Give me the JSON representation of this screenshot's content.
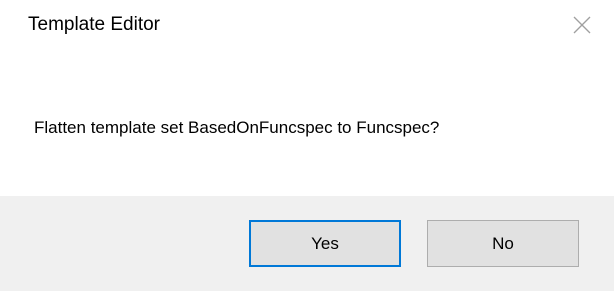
{
  "window": {
    "title": "Template Editor",
    "close_icon": "close-icon"
  },
  "message": {
    "text": "Flatten template set BasedOnFuncspec to Funcspec?"
  },
  "buttons": {
    "yes_label": "Yes",
    "no_label": "No",
    "default_button": "Yes"
  },
  "colors": {
    "footer_background": "#f0f0f0",
    "button_background": "#e1e1e1",
    "button_border": "#adadad",
    "focus_border": "#0078d7",
    "close_icon": "#a0a0a0"
  }
}
